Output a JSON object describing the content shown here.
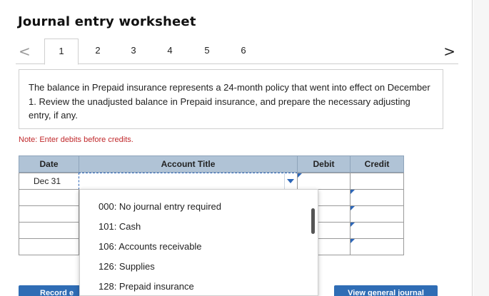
{
  "header": {
    "title": "Journal entry worksheet"
  },
  "nav": {
    "prev": "<",
    "next": ">",
    "tabs": [
      "1",
      "2",
      "3",
      "4",
      "5",
      "6"
    ]
  },
  "question": {
    "text": "The balance in Prepaid insurance represents a 24-month policy that went into effect on December 1. Review the unadjusted balance in Prepaid insurance, and prepare the necessary adjusting entry, if any."
  },
  "note": "Note: Enter debits before credits.",
  "table": {
    "headers": {
      "date": "Date",
      "account": "Account Title",
      "debit": "Debit",
      "credit": "Credit"
    },
    "first_row_date": "Dec 31"
  },
  "dropdown": {
    "options": [
      "000: No journal entry required",
      "101: Cash",
      "106: Accounts receivable",
      "126: Supplies",
      "128: Prepaid insurance"
    ]
  },
  "buttons": {
    "record": "Record e",
    "view_journal": "View general journal"
  },
  "colors": {
    "accent": "#2f6db5",
    "header_bg": "#b0c3d6",
    "note": "#c0282b"
  }
}
